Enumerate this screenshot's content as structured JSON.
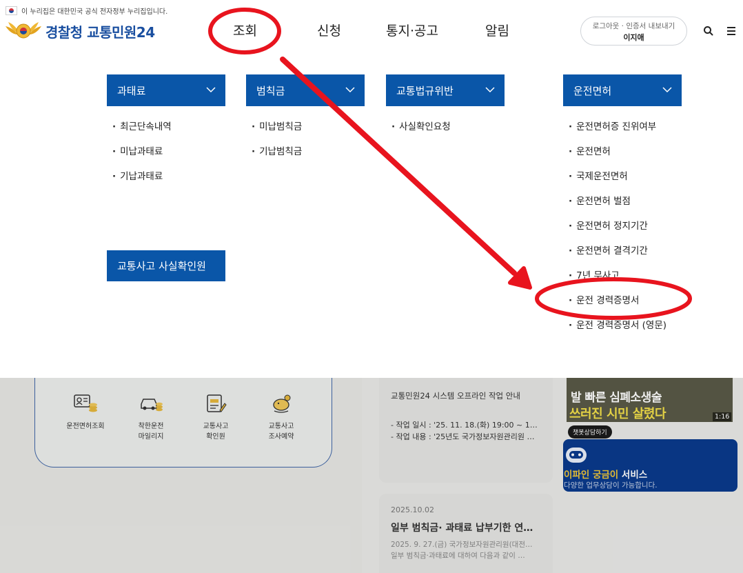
{
  "header": {
    "gov_notice": "이 누리집은 대한민국 공식 전자정부 누리집입니다.",
    "logo_part1": "경찰청",
    "logo_part2": "교통민원24",
    "nav": [
      "조회",
      "신청",
      "통지·공고",
      "알림"
    ],
    "login_links": "로그아웃 · 인증서 내보내기",
    "user_name": "이지애"
  },
  "mega_menu": {
    "columns": [
      {
        "title": "과태료",
        "items": [
          "최근단속내역",
          "미납과태료",
          "기납과태료"
        ]
      },
      {
        "title": "범칙금",
        "items": [
          "미납범칙금",
          "기납범칙금"
        ]
      },
      {
        "title": "교통법규위반",
        "items": [
          "사실확인요청"
        ]
      },
      {
        "title": "운전면허",
        "items": [
          "운전면허증 진위여부",
          "운전면허",
          "국제운전면허",
          "운전면허 벌점",
          "운전면허 정지기간",
          "운전면허 결격기간",
          "7년 무사고",
          "운전 경력증명서",
          "운전 경력증명서 (영문)"
        ]
      }
    ],
    "accident_button": "교통사고 사실확인원"
  },
  "background": {
    "services": [
      {
        "line1": "운전면허조회",
        "line2": "",
        "icon": "license-icon"
      },
      {
        "line1": "착한운전",
        "line2": "마일리지",
        "icon": "car-coins-icon"
      },
      {
        "line1": "교통사고",
        "line2": "확인원",
        "icon": "document-pen-icon"
      },
      {
        "line1": "교통사고",
        "line2": "조사예약",
        "icon": "piggy-bank-icon"
      }
    ],
    "notice": {
      "title": "교통민원24 시스템 오프라인 작업 안내",
      "line1": "- 작업 일시 : '25. 11. 18.(화) 19:00 ~ 11. 1…",
      "line2": "- 작업 내용 : '25년도 국가정보자원관리원 …"
    },
    "news": {
      "date": "2025.10.02",
      "title": "일부 범칙금· 과태료 납부기한 연…",
      "body1": "2025. 9. 27.(금) 국가정보자원관리원(대전…",
      "body2": "일부 범칙금·과태료에 대하여 다음과 같이 …"
    },
    "video": {
      "text1": "발 빠른 심폐소생술",
      "text2": "쓰러진 시민 살렸다",
      "duration": "1:16"
    },
    "chatbot": {
      "bubble": "챗봇상담하기",
      "title_highlight": "이파인 궁금이",
      "title_rest": " 서비스",
      "desc": "다양한 업무상담이 가능합니다."
    }
  },
  "colors": {
    "primary_blue": "#0a56a8",
    "annotation_red": "#e8141e"
  }
}
